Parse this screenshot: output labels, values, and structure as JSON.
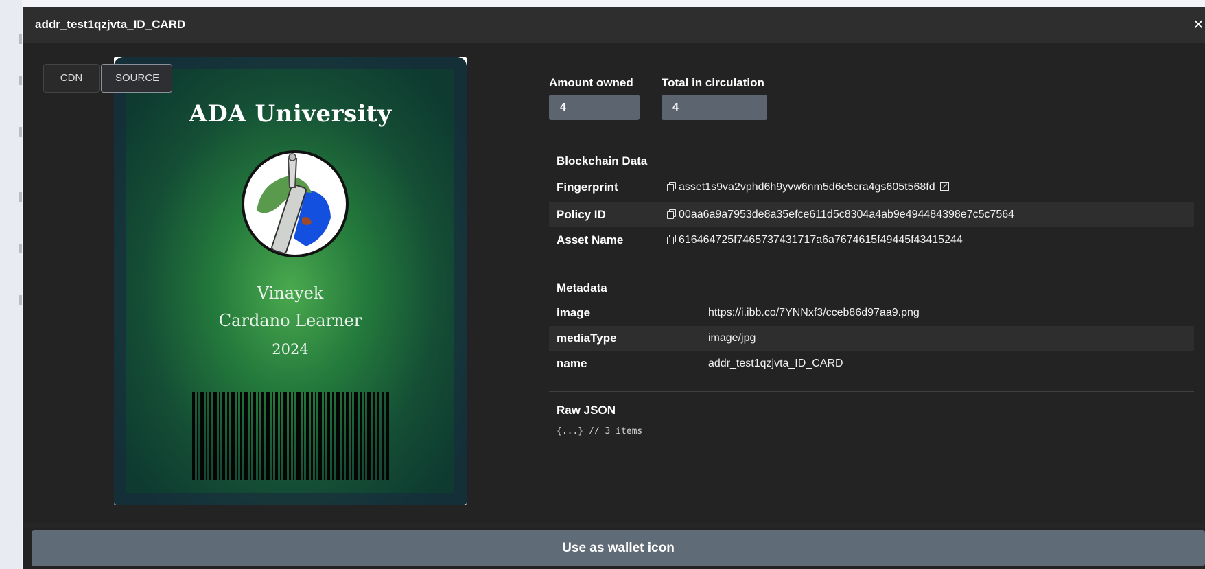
{
  "modal": {
    "title": "addr_test1qzjvta_ID_CARD",
    "close_label": "×"
  },
  "image_toggle": {
    "cdn_label": "CDN",
    "source_label": "SOURCE",
    "selected": "SOURCE"
  },
  "card": {
    "title": "ADA University",
    "person": "Vinayek",
    "role": "Cardano Learner",
    "year": "2024"
  },
  "amounts": {
    "owned_label": "Amount owned",
    "owned_value": "4",
    "circulation_label": "Total in circulation",
    "circulation_value": "4"
  },
  "blockchain": {
    "section_title": "Blockchain Data",
    "rows": [
      {
        "key": "Fingerprint",
        "value": "asset1s9va2vphd6h9yvw6nm5d6e5cra4gs605t568fd"
      },
      {
        "key": "Policy ID",
        "value": "00aa6a9a7953de8a35efce611d5c8304a4ab9e494484398e7c5c7564"
      },
      {
        "key": "Asset Name",
        "value": "616464725f7465737431717a6a7674615f49445f43415244"
      }
    ]
  },
  "metadata": {
    "section_title": "Metadata",
    "rows": [
      {
        "key": "image",
        "value": "https://i.ibb.co/7YNNxf3/cceb86d97aa9.png"
      },
      {
        "key": "mediaType",
        "value": "image/jpg"
      },
      {
        "key": "name",
        "value": "addr_test1qzjvta_ID_CARD"
      }
    ]
  },
  "raw_json": {
    "section_title": "Raw JSON",
    "summary": "{...} // 3 items"
  },
  "footer": {
    "wallet_button_label": "Use as wallet icon"
  },
  "colors": {
    "modal_bg": "#232323",
    "titlebar_bg": "#2e2e2e",
    "button_bg": "#606b78",
    "amount_box_bg": "#5c6470",
    "card_green": "#247a3c"
  }
}
